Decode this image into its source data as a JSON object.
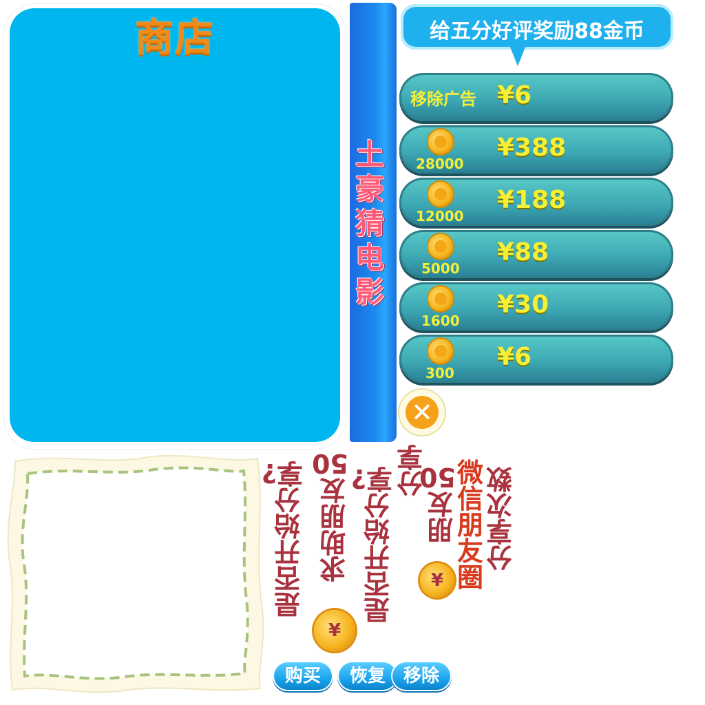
{
  "shop": {
    "title": "商店"
  },
  "banner": {
    "title": "土豪猜电影"
  },
  "bubble": {
    "text": "给五分好评奖励88金币"
  },
  "rows": [
    {
      "kind": "remove-ads",
      "label": "移除广告",
      "price": "¥6"
    },
    {
      "kind": "coins",
      "amount": "28000",
      "price": "¥388"
    },
    {
      "kind": "coins",
      "amount": "12000",
      "price": "¥188"
    },
    {
      "kind": "coins",
      "amount": "5000",
      "price": "¥88"
    },
    {
      "kind": "coins",
      "amount": "1600",
      "price": "¥30"
    },
    {
      "kind": "coins",
      "amount": "300",
      "price": "¥6"
    }
  ],
  "strips": {
    "s1": "是否开始分享?",
    "s2": "求助朋友50",
    "s3": "是否开始分享?",
    "s4": "分享",
    "s5": "朋友50",
    "s6": "微信朋友圈",
    "s7": "分享次数"
  },
  "coin_symbol": "¥",
  "buttons": {
    "buy": "购买",
    "restore": "恢复",
    "remove": "移除"
  },
  "colors": {
    "shop_bg": "#00b6ee",
    "title_orange": "#f08a18",
    "row_teal": "#3ea9b4",
    "price_yellow": "#f5ef36",
    "button_blue": "#1aa3ec"
  }
}
